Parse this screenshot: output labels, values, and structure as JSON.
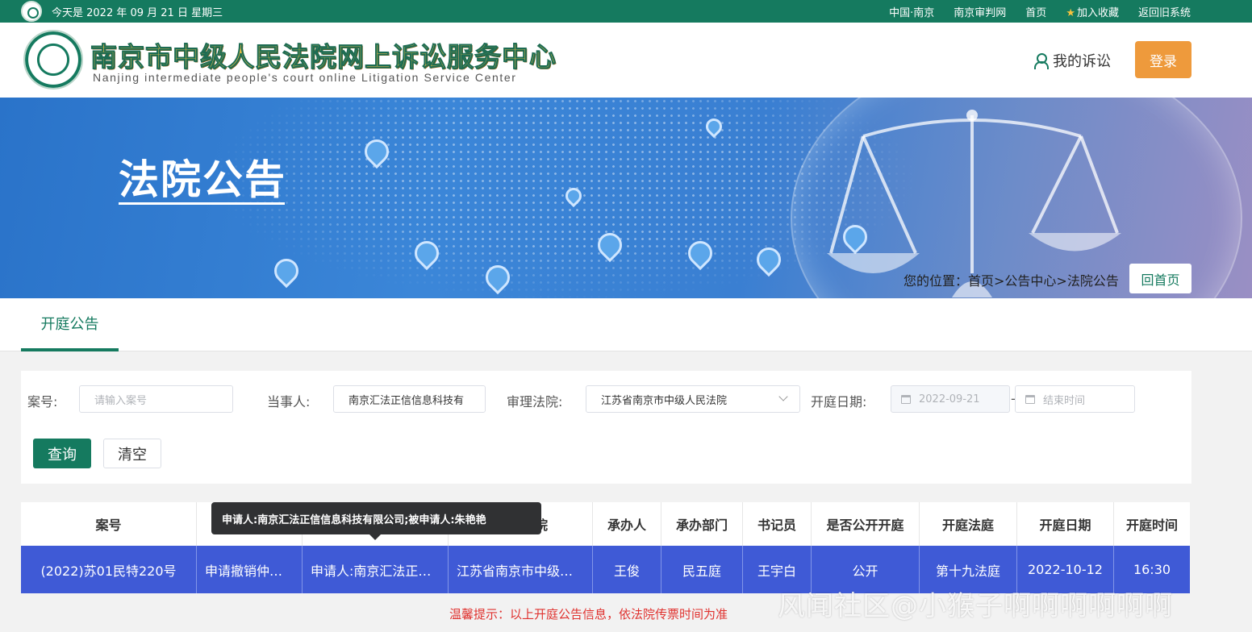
{
  "topbar": {
    "date": "今天是 2022 年 09 月 21 日 星期三",
    "links": [
      "中国·南京",
      "南京审判网",
      "首页",
      "加入收藏",
      "返回旧系统"
    ]
  },
  "header": {
    "title": "南京市中级人民法院网上诉讼服务中心",
    "subtitle": "Nanjing intermediate people's court online Litigation Service Center",
    "my_litigation": "我的诉讼",
    "login": "登录"
  },
  "banner": {
    "title": "法院公告",
    "breadcrumb": "您的位置：首页>公告中心>法院公告",
    "home_button": "回首页"
  },
  "tabs": {
    "active": "开庭公告"
  },
  "search": {
    "case_no_label": "案号:",
    "case_no_placeholder": "请输入案号",
    "party_label": "当事人:",
    "party_value": "南京汇法正信信息科技有",
    "court_label": "审理法院:",
    "court_value": "江苏省南京市中级人民法院",
    "date_label": "开庭日期:",
    "date_start": "2022-09-21",
    "date_sep": "-",
    "date_end_placeholder": "结束时间",
    "query_button": "查询",
    "clear_button": "清空"
  },
  "table": {
    "columns": [
      "案号",
      "",
      "",
      "院",
      "承办人",
      "承办部门",
      "书记员",
      "是否公开开庭",
      "开庭法庭",
      "开庭日期",
      "开庭时间"
    ],
    "rows": [
      [
        "(2022)苏01民特220号",
        "申请撤销仲裁裁决",
        "申请人:南京汇法正信信息科技有限公司",
        "江苏省南京市中级人民法院",
        "王俊",
        "民五庭",
        "王宇白",
        "公开",
        "第十九法庭",
        "2022-10-12",
        "16:30"
      ]
    ]
  },
  "tooltip": "申请人:南京汇法正信信息科技有限公司;被申请人:朱艳艳",
  "tip": "温馨提示：以上开庭公告信息，依法院传票时间为准",
  "watermark": "风闻社区@小猴子啊啊啊啊啊啊"
}
